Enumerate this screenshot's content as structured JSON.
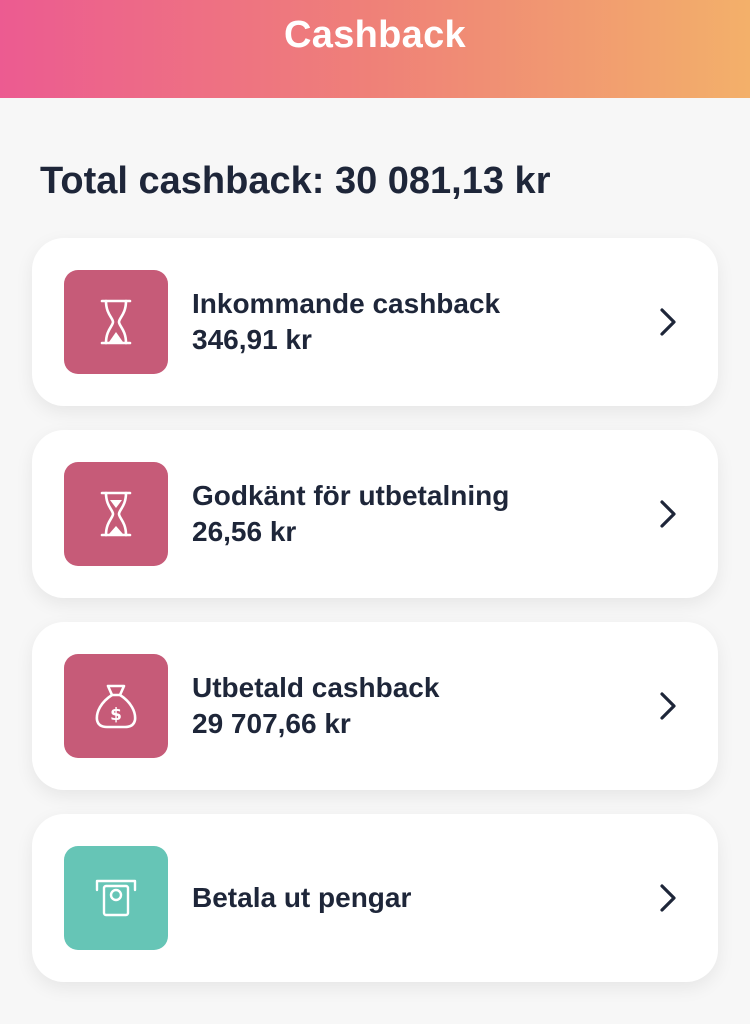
{
  "header": {
    "title": "Cashback"
  },
  "summary": {
    "total_text": "Total cashback: 30 081,13 kr"
  },
  "items": [
    {
      "label": "Inkommande cashback",
      "amount": "346,91 kr",
      "icon": "hourglass-icon",
      "color": "#c65b78"
    },
    {
      "label": "Godkänt för utbetalning",
      "amount": "26,56 kr",
      "icon": "hourglass-icon",
      "color": "#c65b78"
    },
    {
      "label": "Utbetald cashback",
      "amount": "29 707,66 kr",
      "icon": "money-bag-icon",
      "color": "#c65b78"
    },
    {
      "label": "Betala ut pengar",
      "amount": "",
      "icon": "atm-withdraw-icon",
      "color": "#66c5b6"
    }
  ],
  "colors": {
    "header_gradient": [
      "#ec5b91",
      "#ef8178",
      "#f3b06a"
    ],
    "background": "#f7f7f7",
    "text": "#1e2639"
  }
}
